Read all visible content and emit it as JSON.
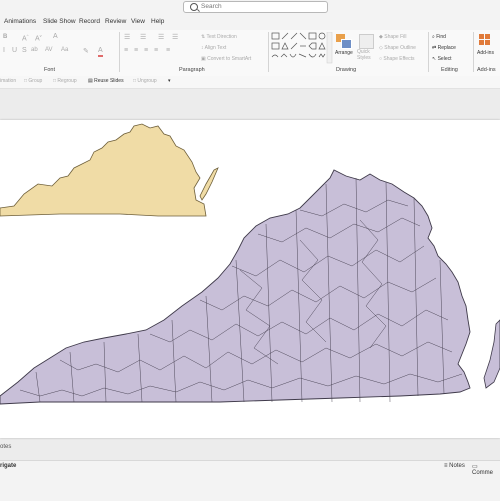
{
  "search": {
    "placeholder": "Search"
  },
  "tabs": [
    "Animations",
    "Slide Show",
    "Record",
    "Review",
    "View",
    "Help"
  ],
  "ribbon": {
    "font_group": "Font",
    "paragraph_group": "Paragraph",
    "drawing_group": "Drawing",
    "editing_group": "Editing",
    "addins_group": "Add-ins",
    "text_direction": "Text Direction",
    "align_text": "Align Text",
    "convert_smartart": "Convert to SmartArt",
    "arrange": "Arrange",
    "quick_styles": "Quick Styles",
    "shape_fill": "Shape Fill",
    "shape_outline": "Shape Outline",
    "shape_effects": "Shape Effects",
    "find": "Find",
    "replace": "Replace",
    "select": "Select",
    "addins": "Add-ins"
  },
  "subbar": {
    "animation": "imation",
    "group": "Group",
    "regroup": "Regroup",
    "reuse_slides": "Reuse Slides",
    "ungroup": "Ungroup"
  },
  "notes_label": "otes",
  "status": {
    "left": "rigate",
    "notes": "Notes",
    "comments": "Comme"
  },
  "colors": {
    "map_fill": "#c8bfd8",
    "outline_fill": "#f0dca6"
  }
}
